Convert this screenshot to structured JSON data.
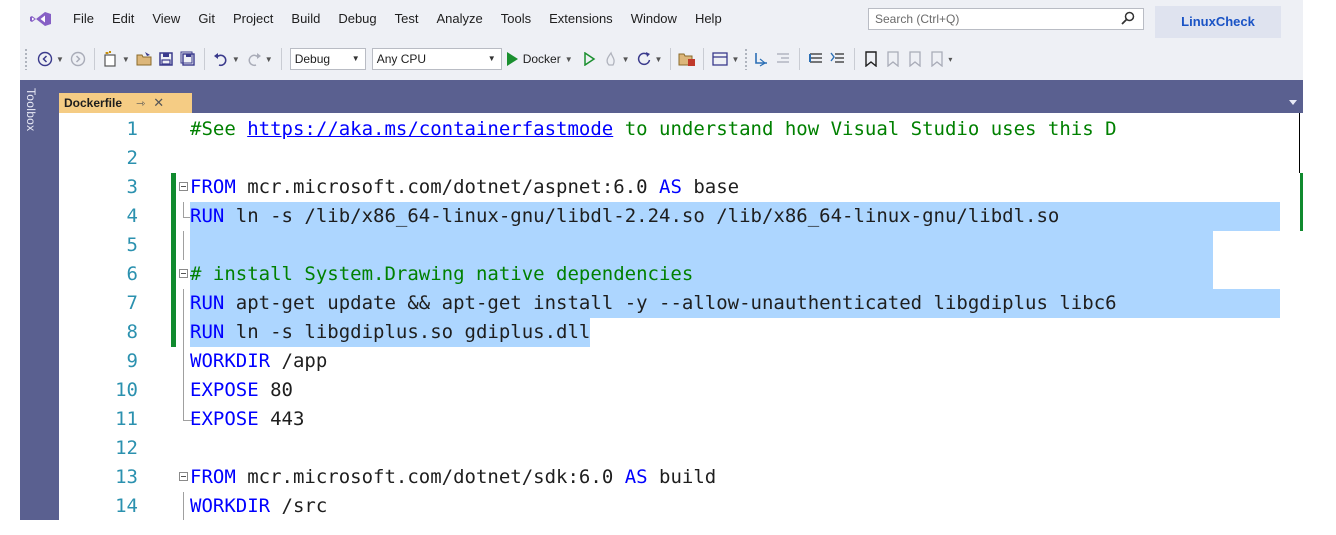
{
  "menu": {
    "items": [
      "File",
      "Edit",
      "View",
      "Git",
      "Project",
      "Build",
      "Debug",
      "Test",
      "Analyze",
      "Tools",
      "Extensions",
      "Window",
      "Help"
    ],
    "search_placeholder": "Search (Ctrl+Q)",
    "solution_name": "LinuxCheck"
  },
  "toolbar": {
    "configuration": "Debug",
    "platform": "Any CPU",
    "run_target": "Docker"
  },
  "sidebar": {
    "toolbox_label": "Toolbox"
  },
  "tabs": [
    {
      "label": "Dockerfile",
      "active": true
    }
  ],
  "editor": {
    "lines": [
      {
        "num": "1",
        "segments": [
          {
            "t": "#See ",
            "c": "cm"
          },
          {
            "t": "https://aka.ms/containerfastmode",
            "c": "lnk"
          },
          {
            "t": " to understand how Visual Studio uses this D",
            "c": "cm"
          }
        ]
      },
      {
        "num": "2",
        "segments": []
      },
      {
        "num": "3",
        "segments": [
          {
            "t": "FROM",
            "c": "kw"
          },
          {
            "t": " mcr.microsoft.com/dotnet/aspnet:6.0 ",
            "c": ""
          },
          {
            "t": "AS",
            "c": "kw"
          },
          {
            "t": " base",
            "c": ""
          }
        ]
      },
      {
        "num": "4",
        "segments": [
          {
            "t": "RUN",
            "c": "kw"
          },
          {
            "t": " ln -s /lib/x86_64-linux-gnu/libdl-2.24.so /lib/x86_64-linux-gnu/libdl.so",
            "c": ""
          }
        ]
      },
      {
        "num": "5",
        "segments": []
      },
      {
        "num": "6",
        "segments": [
          {
            "t": "# install System.Drawing native dependencies",
            "c": "cm"
          }
        ]
      },
      {
        "num": "7",
        "segments": [
          {
            "t": "RUN",
            "c": "kw"
          },
          {
            "t": " apt-get update && apt-get install -y --allow-unauthenticated libgdiplus libc6",
            "c": ""
          }
        ]
      },
      {
        "num": "8",
        "segments": [
          {
            "t": "RUN",
            "c": "kw"
          },
          {
            "t": " ln -s libgdiplus.so gdiplus.dll",
            "c": ""
          }
        ]
      },
      {
        "num": "9",
        "segments": [
          {
            "t": "WORKDIR",
            "c": "kw"
          },
          {
            "t": " /app",
            "c": ""
          }
        ]
      },
      {
        "num": "10",
        "segments": [
          {
            "t": "EXPOSE",
            "c": "kw"
          },
          {
            "t": " 80",
            "c": ""
          }
        ]
      },
      {
        "num": "11",
        "segments": [
          {
            "t": "EXPOSE",
            "c": "kw"
          },
          {
            "t": " 443",
            "c": ""
          }
        ]
      },
      {
        "num": "12",
        "segments": []
      },
      {
        "num": "13",
        "segments": [
          {
            "t": "FROM",
            "c": "kw"
          },
          {
            "t": " mcr.microsoft.com/dotnet/sdk:6.0 ",
            "c": ""
          },
          {
            "t": "AS",
            "c": "kw"
          },
          {
            "t": " build",
            "c": ""
          }
        ]
      },
      {
        "num": "14",
        "segments": [
          {
            "t": "WORKDIR",
            "c": "kw"
          },
          {
            "t": " /src",
            "c": ""
          }
        ]
      }
    ]
  }
}
